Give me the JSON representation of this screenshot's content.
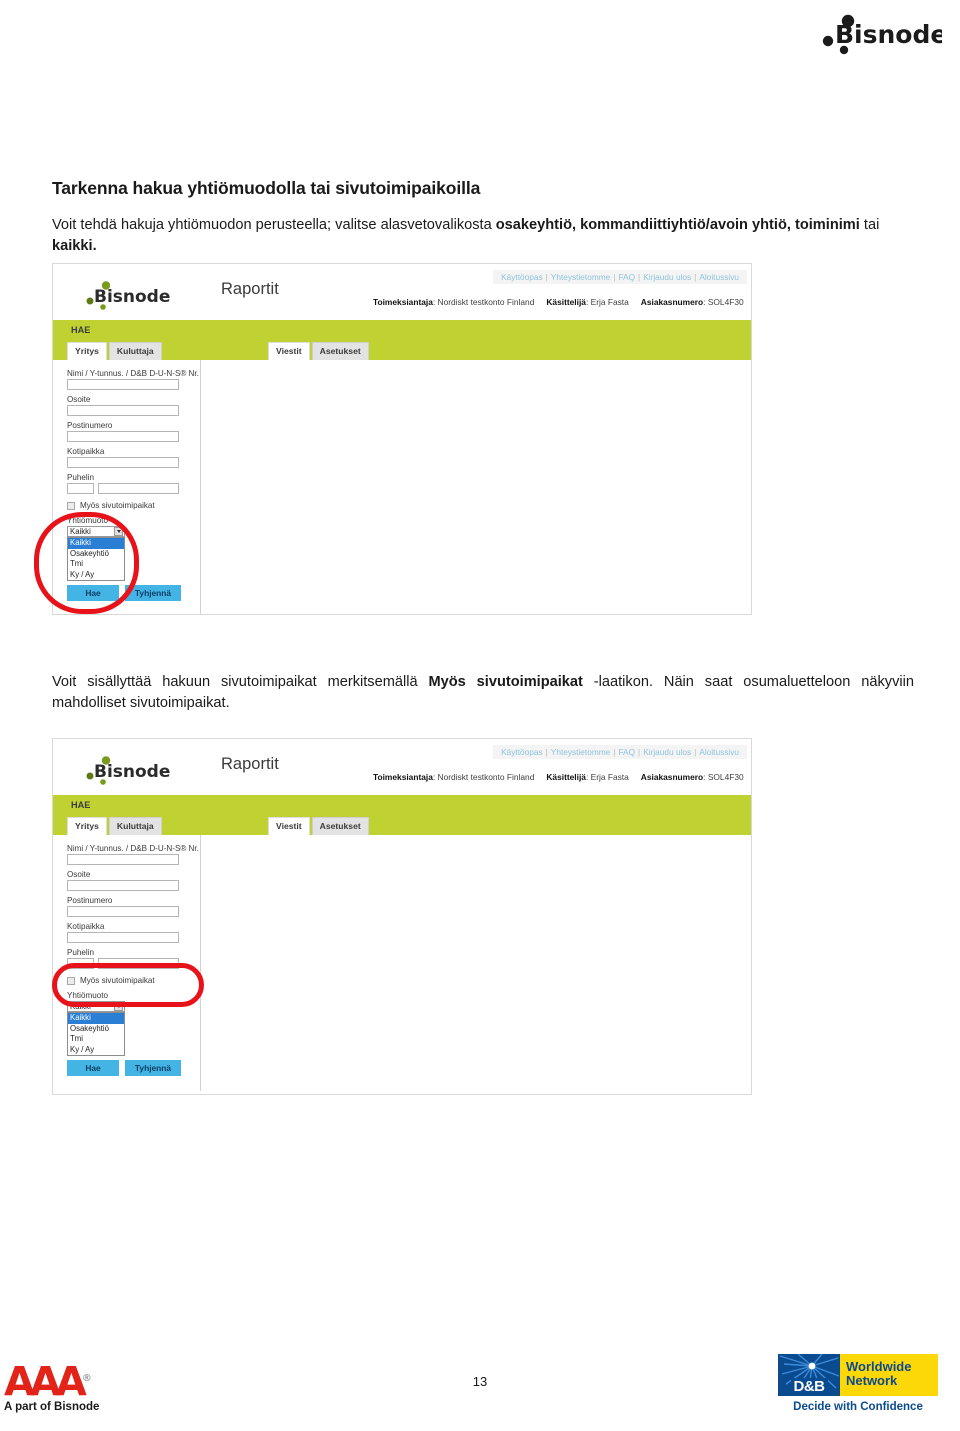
{
  "brand": {
    "name": "Bisnode",
    "accent_green": "#bfd231",
    "accent_blue": "#43b4e4",
    "annotation_red": "#e8131a",
    "link_blue": "#8fc4dc"
  },
  "header": {
    "logo_name": "bisnode-logo"
  },
  "document": {
    "title": "Tarkenna hakua yhtiömuodolla tai sivutoimipaikoilla",
    "paragraph_1": {
      "part_1": "Voit tehdä hakuja yhtiömuodon perusteella; valitse alasvetovalikosta ",
      "bold_1": "osakeyhtiö, kommandiittiyhtiö/avoin yhtiö, toiminimi",
      "part_2": " tai ",
      "bold_2": "kaikki."
    },
    "paragraph_2": {
      "part_1": "Voit sisällyttää hakuun sivutoimipaikat merkitsemällä ",
      "bold_1": "Myös sivutoimipaikat",
      "part_2": " -laatikon. Näin saat osumaluetteloon näkyviin mahdolliset sivutoimipaikat."
    }
  },
  "app": {
    "logo_name": "bisnode-logo",
    "section_title": "Raportit",
    "top_links": [
      "Käyttöopas",
      "Yhteystietomme",
      "FAQ",
      "Kirjaudu ulos",
      "Aloitussivu"
    ],
    "meta": [
      {
        "label": "Toimeksiantaja",
        "value": "Nordiskt testkonto Finland"
      },
      {
        "label": "Käsittelijä",
        "value": "Erja Fasta"
      },
      {
        "label": "Asiakasnumero",
        "value": "SOL4F30"
      }
    ],
    "search_bar_label": "HAE",
    "left_tabs": [
      {
        "label": "Yritys",
        "active": true
      },
      {
        "label": "Kuluttaja",
        "active": false
      }
    ],
    "right_tabs": [
      {
        "label": "Viestit",
        "active": true
      },
      {
        "label": "Asetukset",
        "active": false
      }
    ],
    "form": {
      "fields": [
        {
          "label": "Nimi / Y-tunnus. / D&B D-U-N-S® Nr.",
          "value": "",
          "placeholder": ""
        },
        {
          "label": "Osoite",
          "value": "",
          "placeholder": ""
        },
        {
          "label": "Postinumero",
          "value": "",
          "placeholder": ""
        },
        {
          "label": "Kotipaikka",
          "value": "",
          "placeholder": ""
        }
      ],
      "phone": {
        "label": "Puhelin",
        "area_value": "",
        "number_value": ""
      },
      "checkbox": {
        "label": "Myös sivutoimipaikat",
        "checked": false
      },
      "select": {
        "label": "Yhtiömuoto",
        "selected": "Kaikki",
        "options": [
          "Kaikki",
          "Osakeyhtiö",
          "Tmi",
          "Ky / Ay"
        ],
        "highlighted": "Kaikki"
      },
      "buttons": {
        "search": "Hae",
        "clear": "Tyhjennä"
      }
    }
  },
  "annotations": [
    {
      "name": "company-form-dropdown-highlight",
      "target": "Yhtiömuoto"
    },
    {
      "name": "branch-offices-checkbox-highlight",
      "target": "Myös sivutoimipaikat"
    }
  ],
  "footer": {
    "aaa_mark": "AAA",
    "aaa_reg": "®",
    "aaa_tagline": "A part of Bisnode",
    "page_number": "13",
    "dnb_abbr": "D&B",
    "dnb_line_1": "Worldwide",
    "dnb_line_2": "Network",
    "dnb_tagline": "Decide with Confidence"
  }
}
